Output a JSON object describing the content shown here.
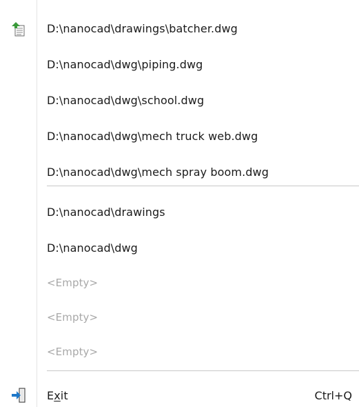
{
  "menu": {
    "recent_files": [
      {
        "label": "D:\\nanocad\\drawings\\batcher.dwg"
      },
      {
        "label": "D:\\nanocad\\dwg\\piping.dwg"
      },
      {
        "label": "D:\\nanocad\\dwg\\school.dwg"
      },
      {
        "label": "D:\\nanocad\\dwg\\mech truck web.dwg"
      },
      {
        "label": "D:\\nanocad\\dwg\\mech spray boom.dwg"
      }
    ],
    "recent_folders": [
      {
        "label": "D:\\nanocad\\drawings"
      },
      {
        "label": "D:\\nanocad\\dwg"
      },
      {
        "label": "<Empty>"
      },
      {
        "label": "<Empty>"
      },
      {
        "label": "<Empty>"
      }
    ],
    "exit": {
      "label_prefix": "E",
      "label_mnemonic": "x",
      "label_suffix": "it",
      "shortcut": "Ctrl+Q"
    }
  },
  "icons": {
    "recent_files": "recent-files-icon",
    "exit": "exit-icon"
  },
  "colors": {
    "disabled_text": "#a8a8a8",
    "exit_icon_arrow": "#1e78c8",
    "recent_icon_arrow": "#3a9a3a"
  }
}
